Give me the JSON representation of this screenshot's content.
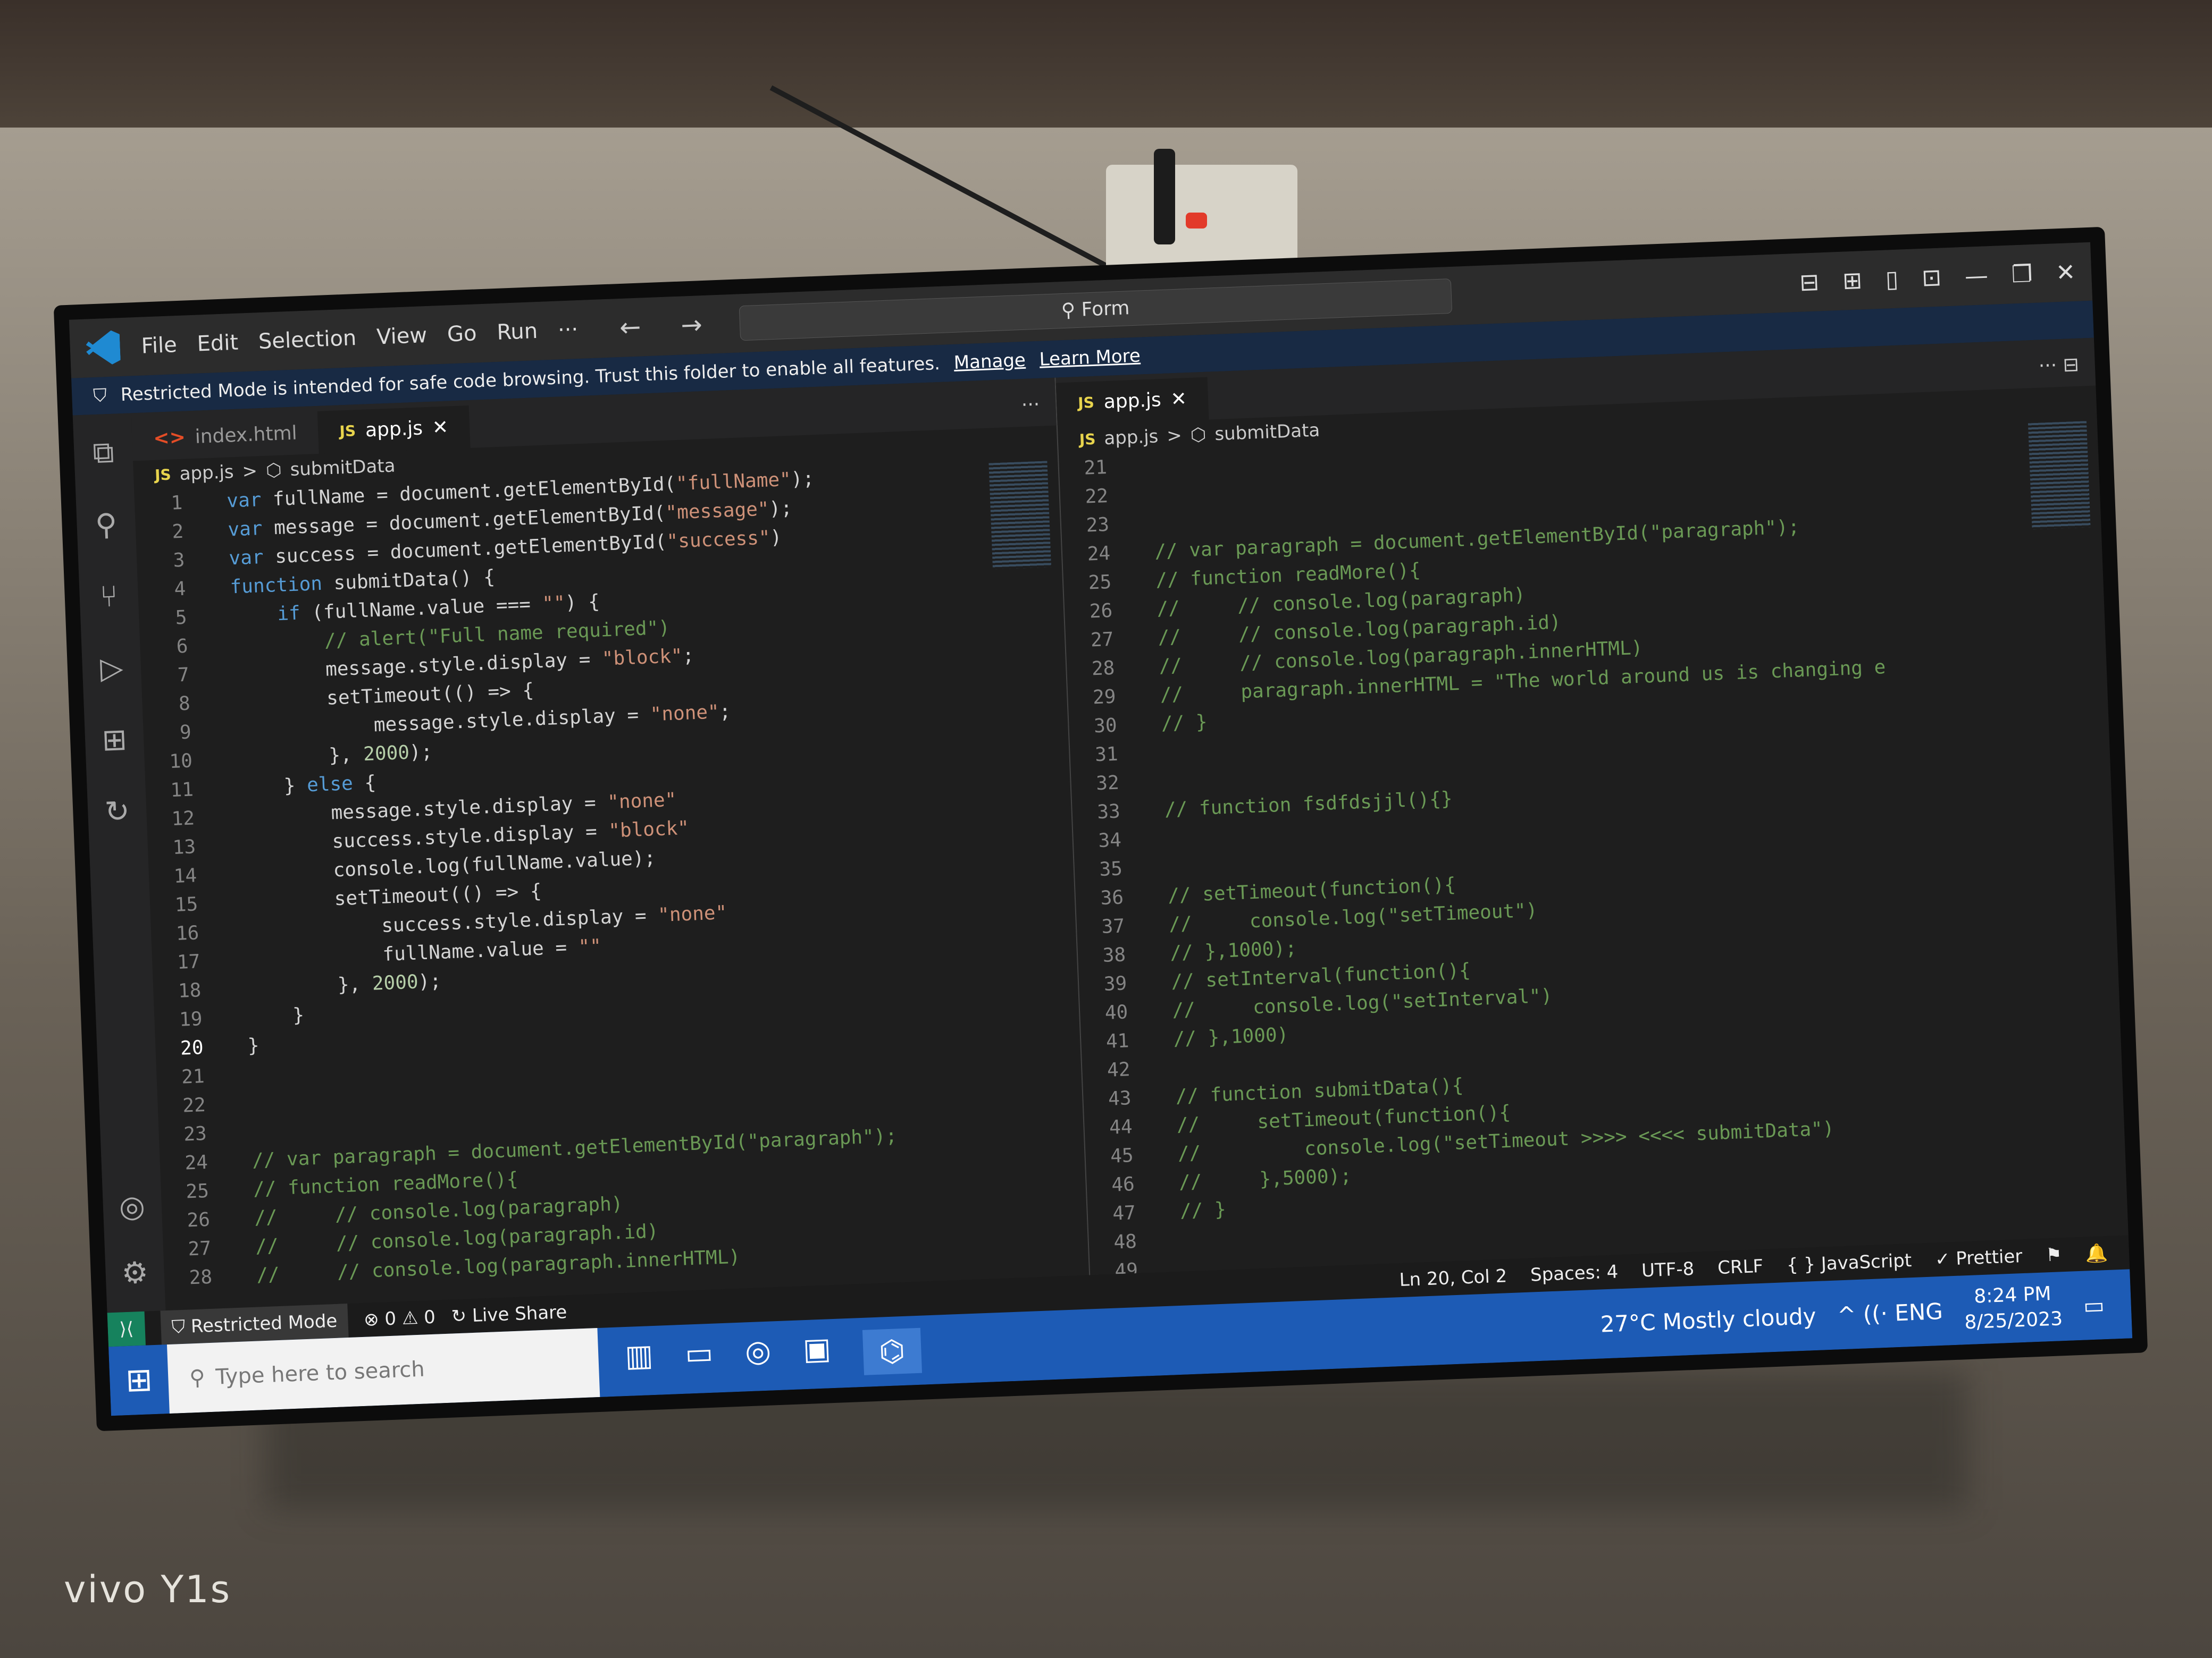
{
  "watermark": "vivo Y1s",
  "titlebar": {
    "menu": [
      "File",
      "Edit",
      "Selection",
      "View",
      "Go",
      "Run",
      "···"
    ],
    "nav": "← →",
    "command_center": "Form",
    "layout_icons": [
      "⊟",
      "⊞",
      "▯",
      "⊡"
    ],
    "minimize": "—",
    "restore": "❐",
    "close": "✕"
  },
  "banner": {
    "text": "Restricted Mode is intended for safe code browsing. Trust this folder to enable all features.",
    "manage": "Manage",
    "learn_more": "Learn More"
  },
  "activity_icons": [
    "⧉",
    "⚲",
    "⑂",
    "▷",
    "⊞",
    "↻"
  ],
  "activity_bottom": [
    "◎",
    "⚙"
  ],
  "left": {
    "tabs": [
      {
        "icon": "<>",
        "label": "index.html"
      },
      {
        "icon": "JS",
        "label": "app.js",
        "close": "✕"
      }
    ],
    "more": "···",
    "breadcrumb": {
      "file": "app.js",
      "sep": ">",
      "symbol": "submitData"
    },
    "lines": [
      {
        "n": "1",
        "t": "  var fullName = document.getElementById(\"fullName\");"
      },
      {
        "n": "2",
        "t": "  var message = document.getElementById(\"message\");"
      },
      {
        "n": "3",
        "t": "  var success = document.getElementById(\"success\")"
      },
      {
        "n": "4",
        "t": "  function submitData() {"
      },
      {
        "n": "5",
        "t": "      if (fullName.value === \"\") {"
      },
      {
        "n": "6",
        "t": "          // alert(\"Full name required\")"
      },
      {
        "n": "7",
        "t": "          message.style.display = \"block\";"
      },
      {
        "n": "8",
        "t": "          setTimeout(() => {"
      },
      {
        "n": "9",
        "t": "              message.style.display = \"none\";"
      },
      {
        "n": "10",
        "t": "          }, 2000);"
      },
      {
        "n": "11",
        "t": "      } else {"
      },
      {
        "n": "12",
        "t": "          message.style.display = \"none\""
      },
      {
        "n": "13",
        "t": "          success.style.display = \"block\""
      },
      {
        "n": "14",
        "t": "          console.log(fullName.value);"
      },
      {
        "n": "15",
        "t": "          setTimeout(() => {"
      },
      {
        "n": "16",
        "t": "              success.style.display = \"none\""
      },
      {
        "n": "17",
        "t": "              fullName.value = \"\""
      },
      {
        "n": "18",
        "t": "          }, 2000);"
      },
      {
        "n": "19",
        "t": "      }"
      },
      {
        "n": "20",
        "t": "  }"
      },
      {
        "n": "21",
        "t": ""
      },
      {
        "n": "22",
        "t": ""
      },
      {
        "n": "23",
        "t": ""
      },
      {
        "n": "24",
        "t": "  // var paragraph = document.getElementById(\"paragraph\");"
      },
      {
        "n": "25",
        "t": "  // function readMore(){"
      },
      {
        "n": "26",
        "t": "  //     // console.log(paragraph)"
      },
      {
        "n": "27",
        "t": "  //     // console.log(paragraph.id)"
      },
      {
        "n": "28",
        "t": "  //     // console.log(paragraph.innerHTML)"
      }
    ]
  },
  "right": {
    "tabs": [
      {
        "icon": "JS",
        "label": "app.js",
        "close": "✕"
      }
    ],
    "more": "··· ⊟",
    "breadcrumb": {
      "file": "app.js",
      "sep": ">",
      "symbol": "submitData"
    },
    "lines": [
      {
        "n": "21",
        "t": ""
      },
      {
        "n": "22",
        "t": ""
      },
      {
        "n": "23",
        "t": ""
      },
      {
        "n": "24",
        "t": "  // var paragraph = document.getElementById(\"paragraph\");"
      },
      {
        "n": "25",
        "t": "  // function readMore(){"
      },
      {
        "n": "26",
        "t": "  //     // console.log(paragraph)"
      },
      {
        "n": "27",
        "t": "  //     // console.log(paragraph.id)"
      },
      {
        "n": "28",
        "t": "  //     // console.log(paragraph.innerHTML)"
      },
      {
        "n": "29",
        "t": "  //     paragraph.innerHTML = \"The world around us is changing e"
      },
      {
        "n": "30",
        "t": "  // }"
      },
      {
        "n": "31",
        "t": ""
      },
      {
        "n": "32",
        "t": ""
      },
      {
        "n": "33",
        "t": "  // function fsdfdsjjl(){}"
      },
      {
        "n": "34",
        "t": ""
      },
      {
        "n": "35",
        "t": ""
      },
      {
        "n": "36",
        "t": "  // setTimeout(function(){"
      },
      {
        "n": "37",
        "t": "  //     console.log(\"setTimeout\")"
      },
      {
        "n": "38",
        "t": "  // },1000);"
      },
      {
        "n": "39",
        "t": "  // setInterval(function(){"
      },
      {
        "n": "40",
        "t": "  //     console.log(\"setInterval\")"
      },
      {
        "n": "41",
        "t": "  // },1000)"
      },
      {
        "n": "42",
        "t": ""
      },
      {
        "n": "43",
        "t": "  // function submitData(){"
      },
      {
        "n": "44",
        "t": "  //     setTimeout(function(){"
      },
      {
        "n": "45",
        "t": "  //         console.log(\"setTimeout >>>> <<<< submitData\")"
      },
      {
        "n": "46",
        "t": "  //     },5000);"
      },
      {
        "n": "47",
        "t": "  // }"
      },
      {
        "n": "48",
        "t": ""
      },
      {
        "n": "49",
        "t": ""
      }
    ]
  },
  "status": {
    "restricted": "Restricted Mode",
    "problems": "⊗ 0 ⚠ 0",
    "live_share": "Live Share",
    "position": "Ln 20, Col 2",
    "spaces": "Spaces: 4",
    "encoding": "UTF-8",
    "eol": "CRLF",
    "language": "{ } JavaScript",
    "prettier": "✓ Prettier",
    "feedback": "⚑",
    "bell": "🔔"
  },
  "taskbar": {
    "start": "⊞",
    "search_placeholder": "Type here to search",
    "icons": [
      "▥",
      "▭",
      "◎",
      "▣",
      "⌬"
    ],
    "weather": "27°C  Mostly cloudy",
    "tray": "^  ((·  ENG",
    "time": "8:24 PM",
    "date": "8/25/2023",
    "notify": "▭"
  }
}
